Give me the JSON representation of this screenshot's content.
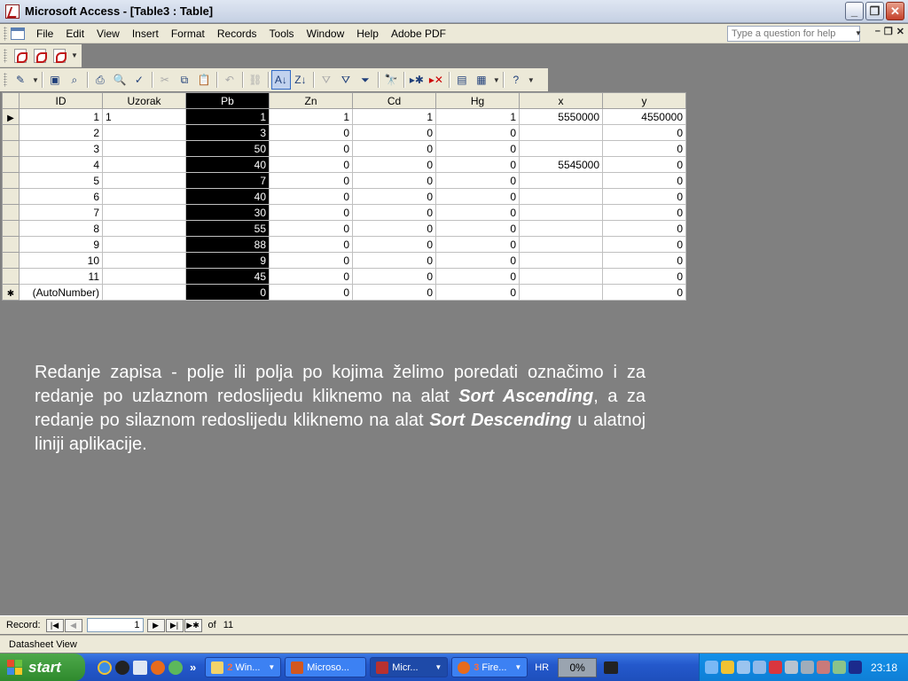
{
  "window": {
    "title": "Microsoft Access - [Table3 : Table]"
  },
  "menu": {
    "items": [
      "File",
      "Edit",
      "View",
      "Insert",
      "Format",
      "Records",
      "Tools",
      "Window",
      "Help",
      "Adobe PDF"
    ],
    "help_placeholder": "Type a question for help"
  },
  "table": {
    "columns": [
      "ID",
      "Uzorak",
      "Pb",
      "Zn",
      "Cd",
      "Hg",
      "x",
      "y"
    ],
    "selected_column": "Pb",
    "rows": [
      [
        "1",
        "1",
        "1",
        "1",
        "1",
        "1",
        "5550000",
        "4550000"
      ],
      [
        "2",
        "",
        "3",
        "0",
        "0",
        "0",
        "",
        "0"
      ],
      [
        "3",
        "",
        "50",
        "0",
        "0",
        "0",
        "",
        "0"
      ],
      [
        "4",
        "",
        "40",
        "0",
        "0",
        "0",
        "5545000",
        "0"
      ],
      [
        "5",
        "",
        "7",
        "0",
        "0",
        "0",
        "",
        "0"
      ],
      [
        "6",
        "",
        "40",
        "0",
        "0",
        "0",
        "",
        "0"
      ],
      [
        "7",
        "",
        "30",
        "0",
        "0",
        "0",
        "",
        "0"
      ],
      [
        "8",
        "",
        "55",
        "0",
        "0",
        "0",
        "",
        "0"
      ],
      [
        "9",
        "",
        "88",
        "0",
        "0",
        "0",
        "",
        "0"
      ],
      [
        "10",
        "",
        "9",
        "0",
        "0",
        "0",
        "",
        "0"
      ],
      [
        "11",
        "",
        "45",
        "0",
        "0",
        "0",
        "",
        "0"
      ]
    ],
    "new_row": [
      "(AutoNumber)",
      "",
      "0",
      "0",
      "0",
      "0",
      "",
      "0"
    ]
  },
  "caption": {
    "part1": "Redanje zapisa -  polje ili polja po kojima želimo poredati označimo i za redanje po uzlaznom redoslijedu kliknemo na alat ",
    "bold1": "Sort Ascending",
    "part2": ", a za redanje po silaznom redoslijedu kliknemo na alat ",
    "bold2": "Sort Descending",
    "part3": " u alatnoj liniji aplikacije."
  },
  "record_nav": {
    "label": "Record:",
    "current": "1",
    "of_label": "of",
    "total": "11"
  },
  "status": {
    "text": "Datasheet View"
  },
  "taskbar": {
    "start": "start",
    "tasks": [
      {
        "badge": "2",
        "label": "Win..."
      },
      {
        "badge": "",
        "label": "Microso..."
      },
      {
        "badge": "",
        "label": "Micr..."
      },
      {
        "badge": "3",
        "label": "Fire..."
      }
    ],
    "language": "HR",
    "progress": "0%",
    "clock": "23:18"
  }
}
